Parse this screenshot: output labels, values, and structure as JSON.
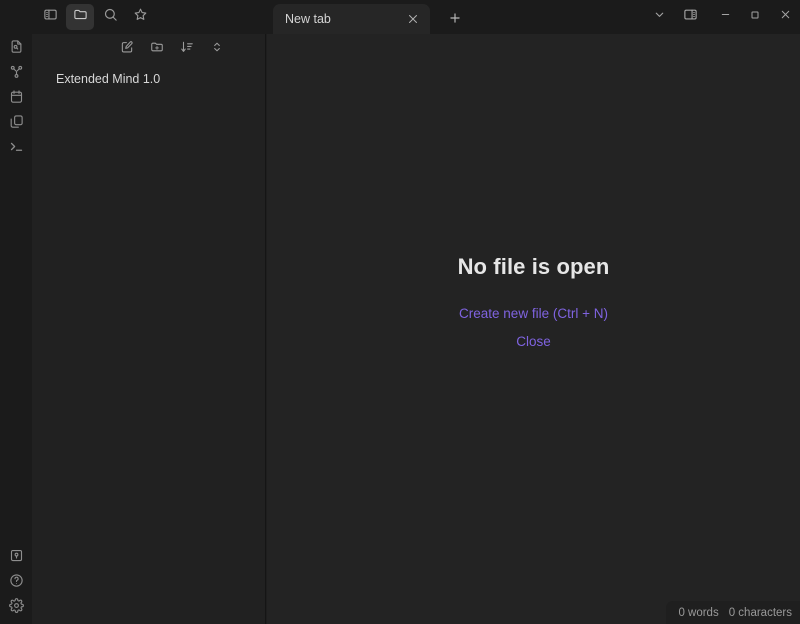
{
  "window": {
    "controls": [
      {
        "name": "dropdown-chevron",
        "icon": "chevron-down",
        "label": ""
      },
      {
        "name": "toggle-right-sidebar",
        "icon": "sidebar-right",
        "label": ""
      },
      {
        "name": "minimize",
        "icon": "minimize",
        "label": ""
      },
      {
        "name": "maximize",
        "icon": "maximize",
        "label": ""
      },
      {
        "name": "close",
        "icon": "close",
        "label": ""
      }
    ]
  },
  "toolbar": {
    "buttons": [
      {
        "name": "toggle-left-sidebar",
        "icon": "sidebar-left",
        "active": false
      },
      {
        "name": "file-explorer",
        "icon": "folder",
        "active": true
      },
      {
        "name": "search",
        "icon": "magnifier",
        "active": false
      },
      {
        "name": "bookmarks",
        "icon": "star",
        "active": false
      }
    ]
  },
  "ribbon": {
    "top_items": [
      {
        "label": "Quick switcher",
        "icon": "file-search-icon"
      },
      {
        "label": "Graph view",
        "icon": "graph-icon"
      },
      {
        "label": "Calendar",
        "icon": "calendar-icon"
      },
      {
        "label": "Canvas",
        "icon": "copy-files-icon"
      },
      {
        "label": "Terminal",
        "icon": "terminal-icon"
      }
    ],
    "bottom_items": [
      {
        "label": "Vault",
        "icon": "vault-icon"
      },
      {
        "label": "Help",
        "icon": "help-icon"
      },
      {
        "label": "Settings",
        "icon": "settings-gear-icon"
      }
    ]
  },
  "tabs": {
    "items": [
      {
        "title": "New tab",
        "active": true
      }
    ],
    "new_tab_label": "+"
  },
  "explorer": {
    "actions": [
      {
        "name": "new-note",
        "icon": "pencil-square-icon"
      },
      {
        "name": "new-folder",
        "icon": "folder-plus-icon"
      },
      {
        "name": "change-sort-order",
        "icon": "sort-icon"
      },
      {
        "name": "expand-collapse-all",
        "icon": "chevrons-updown-icon"
      }
    ],
    "files": [
      {
        "name": "Extended Mind 1.0",
        "type": "note"
      }
    ]
  },
  "main": {
    "empty_title": "No file is open",
    "primary_action": "Create new file (Ctrl + N)",
    "secondary_action": "Close"
  },
  "statusbar": {
    "items": [
      {
        "label": "0 words"
      },
      {
        "label": "0 characters"
      }
    ]
  },
  "colors": {
    "accent": "#7f63e0",
    "background_primary": "#232323",
    "background_secondary": "#212121",
    "titlebar": "#1b1b1b",
    "text_normal": "#d8d8d8",
    "text_muted": "#999999"
  }
}
